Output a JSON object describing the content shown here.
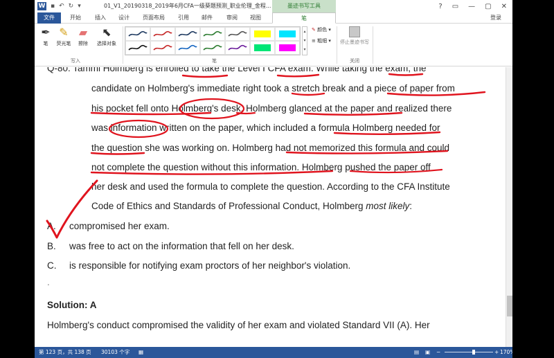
{
  "titlebar": {
    "app_icon": "W",
    "document_title": "01_V1_20190318_2019年6月CFA一级葵题预测_职业伦理_金程...",
    "context_tab_title": "墨迹书写工具",
    "controls": [
      "?",
      "▭",
      "—",
      "▢",
      "✕"
    ]
  },
  "tabs": [
    "文件",
    "开始",
    "插入",
    "设计",
    "页面布局",
    "引用",
    "邮件",
    "审阅",
    "视图",
    "笔"
  ],
  "signin": "登录",
  "ribbon": {
    "write_group": {
      "buttons": [
        "笔",
        "荧光笔",
        "擦除",
        "选择对象"
      ],
      "label": "写入"
    },
    "pens_group": {
      "label": "笔",
      "pen_colors_row1": [
        "#1f3a60",
        "#c62828",
        "#1f3a60",
        "#2e7d32",
        "#555555"
      ],
      "pen_colors_row2": [
        "#111111",
        "#c62828",
        "#1565c0",
        "#2e7d32",
        "#6a1b9a"
      ],
      "highlighters_row1": [
        "#ffff00",
        "#00e5ff"
      ],
      "highlighters_row2": [
        "#00e676",
        "#ff00ff"
      ],
      "color_option": "颜色",
      "thickness_option": "粗细"
    },
    "close_group": {
      "button": "停止墨迹书写",
      "label": "关闭"
    }
  },
  "document": {
    "question_lines": [
      "Q-80.  Tammi Holmberg is enrolled to take the Level I CFA exam. While taking the exam, the",
      "candidate on Holmberg's immediate right took a stretch break and a piece of paper from",
      "his pocket fell onto Holmberg's desk. Holmberg glanced at the paper and realized there",
      "was information written on the paper, which included a formula Holmberg needed for",
      "the question she was working on. Holmberg had not memorized this formula and could",
      "not complete the question without this information. Holmberg pushed the paper off",
      "her desk and used the formula to complete the question. According to the CFA Institute"
    ],
    "question_last_line_prefix": "Code of Ethics and Standards of Professional Conduct, Holmberg ",
    "question_last_line_italic": "most likely",
    "question_last_line_suffix": ":",
    "options": [
      {
        "letter": "A.",
        "text": "compromised her exam."
      },
      {
        "letter": "B.",
        "text": "was free to act on the information that fell on her desk."
      },
      {
        "letter": "C.",
        "text": "is responsible for notifying exam proctors of her neighbor's violation."
      }
    ],
    "blank_mark": ".",
    "solution_heading": "Solution: A",
    "solution_text": "Holmberg's conduct compromised the validity of her exam and violated Standard VII (A). Her",
    "ink_color": "#e0141e"
  },
  "statusbar": {
    "page": "第 123 页，共 138 页",
    "words": "30103 个字",
    "zoom": "170%"
  }
}
